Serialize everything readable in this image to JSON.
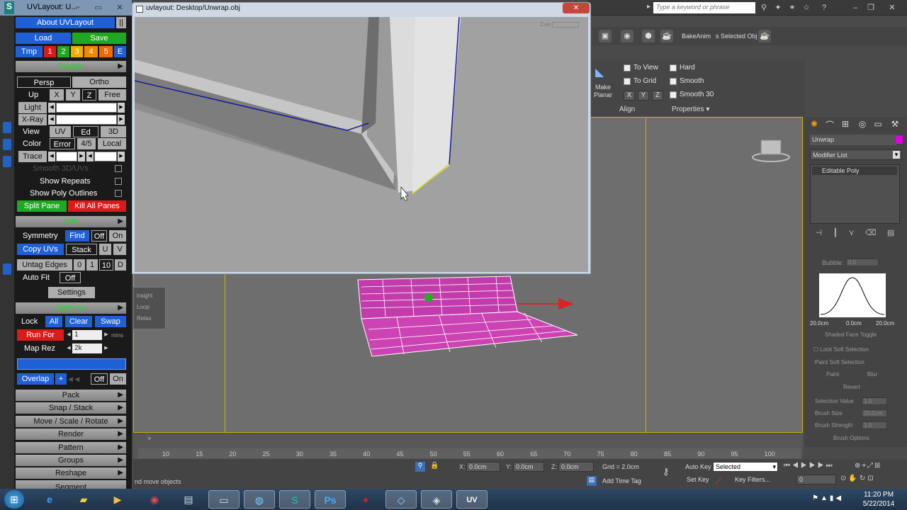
{
  "uvlayout": {
    "title": "UVLayout: U...",
    "logo": "S",
    "about_label": "About UVLayout",
    "load_label": "Load",
    "save_label": "Save",
    "tmp_label": "Tmp",
    "tmp_slots": [
      "1",
      "2",
      "3",
      "4",
      "5",
      "E"
    ],
    "display_section": "Display",
    "persp_label": "Persp",
    "ortho_label": "Ortho",
    "up_label": "Up",
    "axes": [
      "X",
      "Y",
      "Z",
      "Free"
    ],
    "light_label": "Light",
    "xray_label": "X-Ray",
    "view_label": "View",
    "view_modes": [
      "UV",
      "Ed",
      "3D"
    ],
    "color_label": "Color",
    "color_modes": [
      "Error",
      "4/5",
      "Local"
    ],
    "trace_label": "Trace",
    "smooth_uvs_label": "Smooth 3D/UVs",
    "show_repeats_label": "Show Repeats",
    "show_outlines_label": "Show Poly Outlines",
    "split_pane_label": "Split Pane",
    "kill_panes_label": "Kill All Panes",
    "edit_section": "Edit",
    "symmetry_label": "Symmetry",
    "find_label": "Find",
    "off_label": "Off",
    "on_label": "On",
    "copy_uvs_label": "Copy UVs",
    "stack_label": "Stack",
    "u_label": "U",
    "v_label": "V",
    "untag_edges_label": "Untag Edges",
    "untag_values": [
      "0",
      "1",
      "10",
      "D"
    ],
    "auto_fit_label": "Auto Fit",
    "settings_label": "Settings",
    "optimize_section": "Optimize",
    "lock_label": "Lock",
    "all_label": "All",
    "clear_label": "Clear",
    "swap_label": "Swap",
    "run_for_label": "Run For",
    "run_for_value": "1",
    "mins_label": "mins",
    "map_rez_label": "Map Rez",
    "map_rez_value": "2k",
    "overlap_label": "Overlap",
    "plus_label": "+",
    "menus": [
      "Pack",
      "Snap / Stack",
      "Move / Scale / Rotate",
      "Render",
      "Pattern",
      "Groups",
      "Reshape",
      "Segment"
    ]
  },
  "uvwindow": {
    "title": "uvlayout: Desktop/Unwrap.obj",
    "cue_label": "Cue"
  },
  "max": {
    "search_placeholder": "Type a keyword or phrase",
    "bakeanim_label": "BakeAnim",
    "selected_obj_label": "s Selected Obj",
    "to_view_label": "To View",
    "to_grid_label": "To Grid",
    "hard_label": "Hard",
    "smooth_label": "Smooth",
    "smooth30_label": "Smooth 30",
    "make_planar_label": "Make Planar",
    "xyz": [
      "X",
      "Y",
      "Z"
    ],
    "align_label": "Align",
    "properties_label": "Properties",
    "object_name": "Unwrap",
    "modifier_list_label": "Modifier List",
    "stack_item": "Editable Poly",
    "bubble_label": "Bubble:",
    "bubble_value": "0.0",
    "curve_labels": [
      "20.0cm",
      "0.0cm",
      "20.0cm"
    ],
    "shaded_face_toggle": "Shaded Face Toggle",
    "lock_soft_selection": "Lock Soft Selection",
    "paint_soft_selection": "Paint Soft Selection",
    "paint_label": "Paint",
    "blur_label": "Blur",
    "revert_label": "Revert",
    "selection_value_label": "Selection Value",
    "selection_value": "1.0",
    "brush_size_label": "Brush Size",
    "brush_size_value": "20.0cm",
    "brush_strength_label": "Brush Strength",
    "brush_strength_value": "1.0",
    "brush_options_label": "Brush Options",
    "rollout_items": [
      "traight",
      "Loop",
      "Relax"
    ],
    "ticks": [
      "10",
      "15",
      "20",
      "25",
      "30",
      "35",
      "40",
      "45",
      "50",
      "55",
      "60",
      "65",
      "70",
      "75",
      "80",
      "85",
      "90",
      "95",
      "100"
    ],
    "x_value": "0.0cm",
    "y_value": "0.0cm",
    "z_value": "0.0cm",
    "grid_label": "Grid = 2.0cm",
    "auto_key_label": "Auto Key",
    "selected_dropdown": "Selected",
    "set_key_label": "Set Key",
    "key_filters_label": "Key Filters...",
    "frame_value": "0",
    "add_time_tag_label": "Add Time Tag",
    "status_text": "nd move objects"
  },
  "taskbar": {
    "time": "11:20 PM",
    "date": "5/22/2014",
    "active_app_label": "UV"
  },
  "colors": {
    "uv_blue": "#2060d6",
    "uv_green": "#20a820",
    "uv_red": "#dd1a1a",
    "viewport_yellow": "#c9b600",
    "mesh_magenta": "#d020c0"
  }
}
